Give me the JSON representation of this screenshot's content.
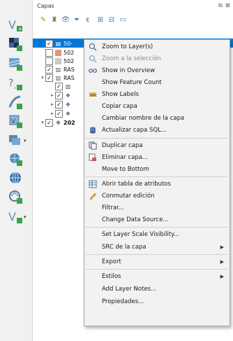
{
  "panel": {
    "title": "Capas"
  },
  "tree": [
    {
      "label": "50-",
      "checked": true,
      "selected": true,
      "icon": "vector-layer-icon"
    },
    {
      "label": "502",
      "checked": false,
      "swatch": "#e4957b"
    },
    {
      "label": "502",
      "checked": false,
      "swatch": "#c9c9c9"
    },
    {
      "label": "RAS",
      "checked": true,
      "icon": "raster-layer-icon"
    },
    {
      "label": "RAS",
      "checked": true,
      "icon": "raster-layer-icon",
      "expanded": true
    },
    {
      "label": "",
      "checked": true,
      "icon": "raster-layer-icon"
    },
    {
      "label": "",
      "checked": true,
      "icon": "group-icon"
    },
    {
      "label": "",
      "checked": true,
      "icon": "group-icon"
    },
    {
      "label": "",
      "checked": true,
      "icon": "group-icon"
    },
    {
      "label": "202",
      "checked": true,
      "icon": "group-icon",
      "expanded": true
    }
  ],
  "menu": {
    "zoom_layer": "Zoom to Layer(s)",
    "zoom_selection": "Zoom a la selección",
    "show_overview": "Show in Overview",
    "show_feature_count": "Show Feature Count",
    "show_labels": "Show Labels",
    "copy_layer": "Copiar capa",
    "rename_layer": "Cambiar nombre de la capa",
    "update_sql": "Actualizar capa SQL...",
    "duplicate": "Duplicar capa",
    "remove": "Eliminar capa...",
    "move_bottom": "Move to Bottom",
    "attr_table": "Abrir tabla de atributos",
    "toggle_edit": "Conmutar edición",
    "filter": "Filtrar...",
    "change_source": "Change Data Source...",
    "scale_visibility": "Set Layer Scale Visibility...",
    "crs": "SRC de la capa",
    "export": "Export",
    "styles": "Estilos",
    "notes": "Add Layer Notes...",
    "properties": "Propiedades..."
  }
}
